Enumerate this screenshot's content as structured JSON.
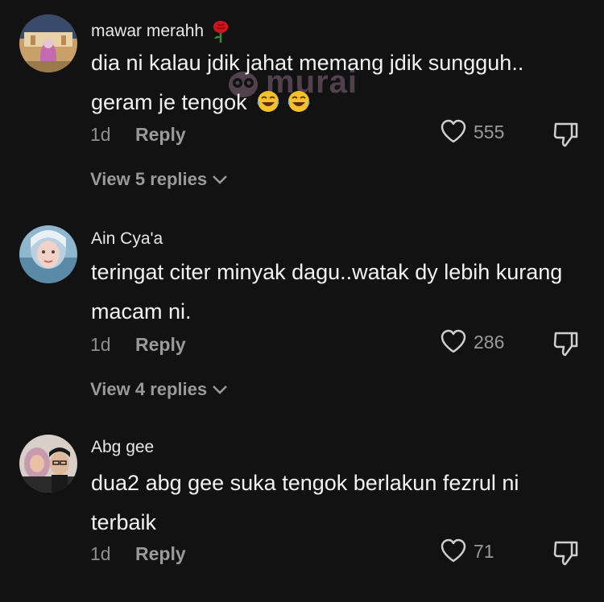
{
  "watermark": {
    "text": "murai"
  },
  "comments": [
    {
      "username": "mawar merahh",
      "username_emoji": "rose-icon",
      "text": "dia ni kalau jdik jahat memang jdik sungguh.. geram je tengok",
      "text_emoji": "laughing-tears-icon",
      "time": "1d",
      "reply_label": "Reply",
      "likes": "555",
      "view_replies": "View 5 replies"
    },
    {
      "username": "Ain Cya'a",
      "text": "teringat citer minyak dagu..watak dy lebih kurang macam ni.",
      "time": "1d",
      "reply_label": "Reply",
      "likes": "286",
      "view_replies": "View 4 replies"
    },
    {
      "username": "Abg gee",
      "text": "dua2 abg gee suka tengok berlakun fezrul ni terbaik",
      "time": "1d",
      "reply_label": "Reply",
      "likes": "71"
    }
  ],
  "colors": {
    "background": "#121212",
    "primary_text": "#f2f2f2",
    "secondary_text": "#9a9a9a"
  }
}
